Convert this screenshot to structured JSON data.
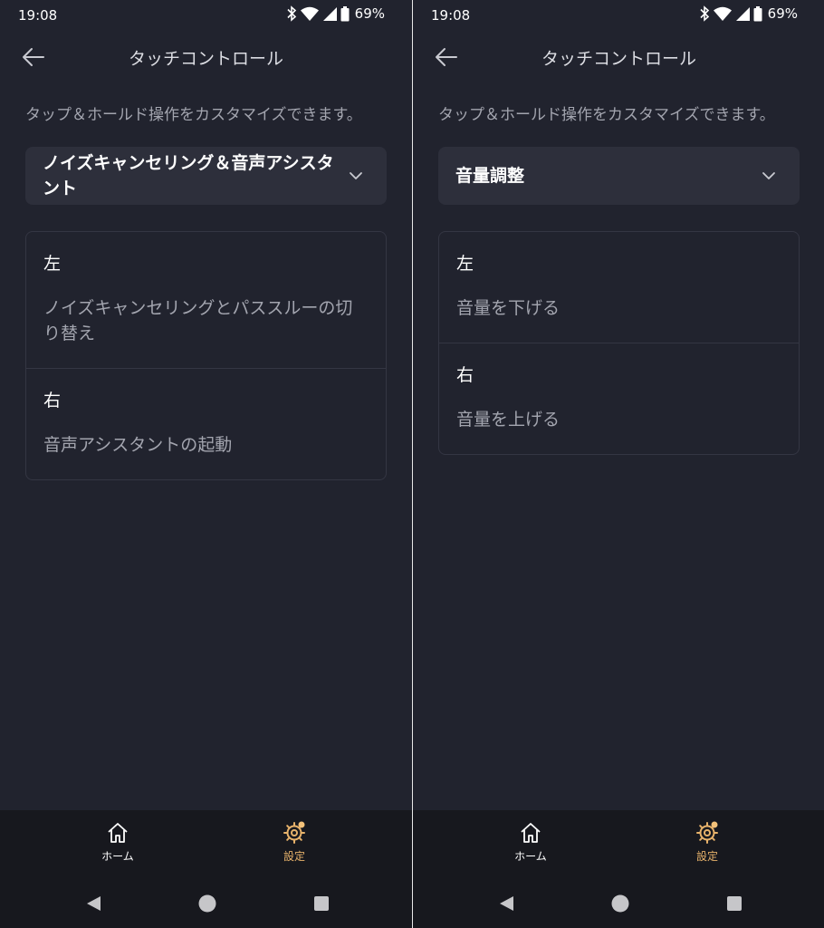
{
  "colors": {
    "background": "#21232e",
    "card_surface": "#2d2f3b",
    "secondary_text": "#a3a5af",
    "bottom_nav": "#17181e",
    "accent": "#e7b26b"
  },
  "screens": [
    {
      "status_bar": {
        "time": "19:08",
        "battery": "69%",
        "icons": [
          "bluetooth-icon",
          "wifi-icon",
          "cellular-icon",
          "battery-icon"
        ]
      },
      "header": {
        "back_icon": "back-arrow-icon",
        "title": "タッチコントロール"
      },
      "description": "タップ＆ホールド操作をカスタマイズできます。",
      "dropdown": {
        "selected": "ノイズキャンセリング＆音声アシスタント",
        "icon": "chevron-down-icon"
      },
      "controls": [
        {
          "side": "左",
          "action": "ノイズキャンセリングとパススルーの切り替え"
        },
        {
          "side": "右",
          "action": "音声アシスタントの起動"
        }
      ],
      "bottom_nav": [
        {
          "label": "ホーム",
          "icon": "home-icon",
          "active": false
        },
        {
          "label": "設定",
          "icon": "gear-icon",
          "active": true
        }
      ],
      "system_nav": [
        "back-triangle-icon",
        "home-circle-icon",
        "recents-square-icon"
      ]
    },
    {
      "status_bar": {
        "time": "19:08",
        "battery": "69%",
        "icons": [
          "bluetooth-icon",
          "wifi-icon",
          "cellular-icon",
          "battery-icon"
        ]
      },
      "header": {
        "back_icon": "back-arrow-icon",
        "title": "タッチコントロール"
      },
      "description": "タップ＆ホールド操作をカスタマイズできます。",
      "dropdown": {
        "selected": "音量調整",
        "icon": "chevron-down-icon"
      },
      "controls": [
        {
          "side": "左",
          "action": "音量を下げる"
        },
        {
          "side": "右",
          "action": "音量を上げる"
        }
      ],
      "bottom_nav": [
        {
          "label": "ホーム",
          "icon": "home-icon",
          "active": false
        },
        {
          "label": "設定",
          "icon": "gear-icon",
          "active": true
        }
      ],
      "system_nav": [
        "back-triangle-icon",
        "home-circle-icon",
        "recents-square-icon"
      ]
    }
  ]
}
